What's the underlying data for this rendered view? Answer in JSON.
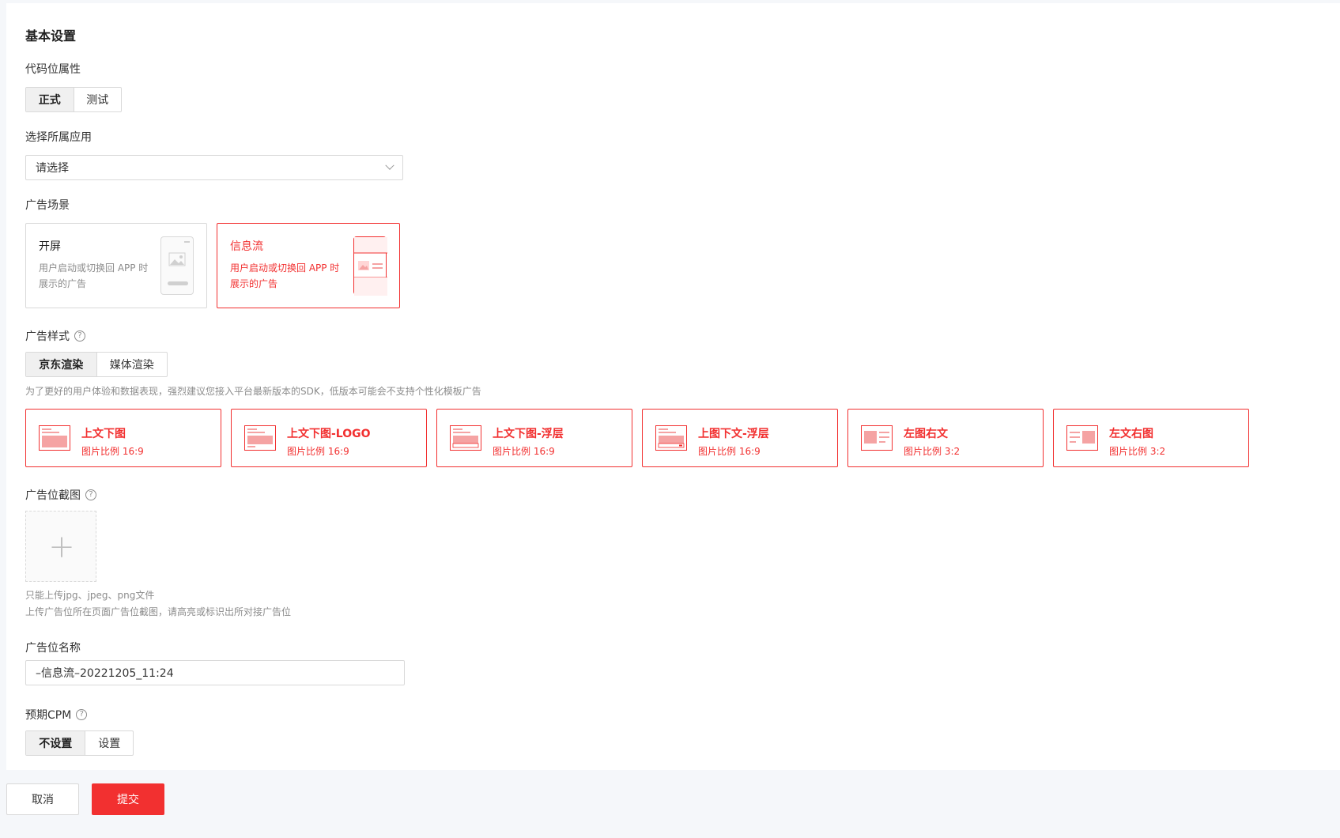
{
  "section_title": "基本设置",
  "code_attr": {
    "label": "代码位属性",
    "options": [
      "正式",
      "测试"
    ],
    "selected": "正式"
  },
  "app_select": {
    "label": "选择所属应用",
    "placeholder": "请选择"
  },
  "scene": {
    "label": "广告场景",
    "cards": [
      {
        "title": "开屏",
        "desc_line1": "用户启动或切换回 APP 时",
        "desc_line2": "展示的广告"
      },
      {
        "title": "信息流",
        "desc_line1": "用户启动或切换回 APP 时",
        "desc_line2": "展示的广告"
      }
    ],
    "selected": "信息流"
  },
  "ad_style": {
    "label": "广告样式",
    "help": "?",
    "options": [
      "京东渲染",
      "媒体渲染"
    ],
    "selected": "京东渲染",
    "hint": "为了更好的用户体验和数据表现，强烈建议您接入平台最新版本的SDK，低版本可能会不支持个性化模板广告",
    "styles": [
      {
        "title": "上文下图",
        "sub": "图片比例 16:9"
      },
      {
        "title": "上文下图-LOGO",
        "sub": "图片比例 16:9"
      },
      {
        "title": "上文下图-浮层",
        "sub": "图片比例 16:9"
      },
      {
        "title": "上图下文-浮层",
        "sub": "图片比例 16:9"
      },
      {
        "title": "左图右文",
        "sub": "图片比例 3:2"
      },
      {
        "title": "左文右图",
        "sub": "图片比例 3:2"
      }
    ]
  },
  "screenshot": {
    "label": "广告位截图",
    "help": "?",
    "upload_glyph": "+",
    "hint1": "只能上传jpg、jpeg、png文件",
    "hint2": "上传广告位所在页面广告位截图，请高亮或标识出所对接广告位"
  },
  "slot_name": {
    "label": "广告位名称",
    "value": "–信息流–20221205_11:24"
  },
  "cpm": {
    "label": "预期CPM",
    "help": "?",
    "options": [
      "不设置",
      "设置"
    ],
    "selected": "不设置"
  },
  "footer": {
    "cancel": "取消",
    "submit": "提交"
  },
  "colors": {
    "accent": "#f23030",
    "border": "#d9d9d9",
    "background": "#f5f7fa"
  }
}
